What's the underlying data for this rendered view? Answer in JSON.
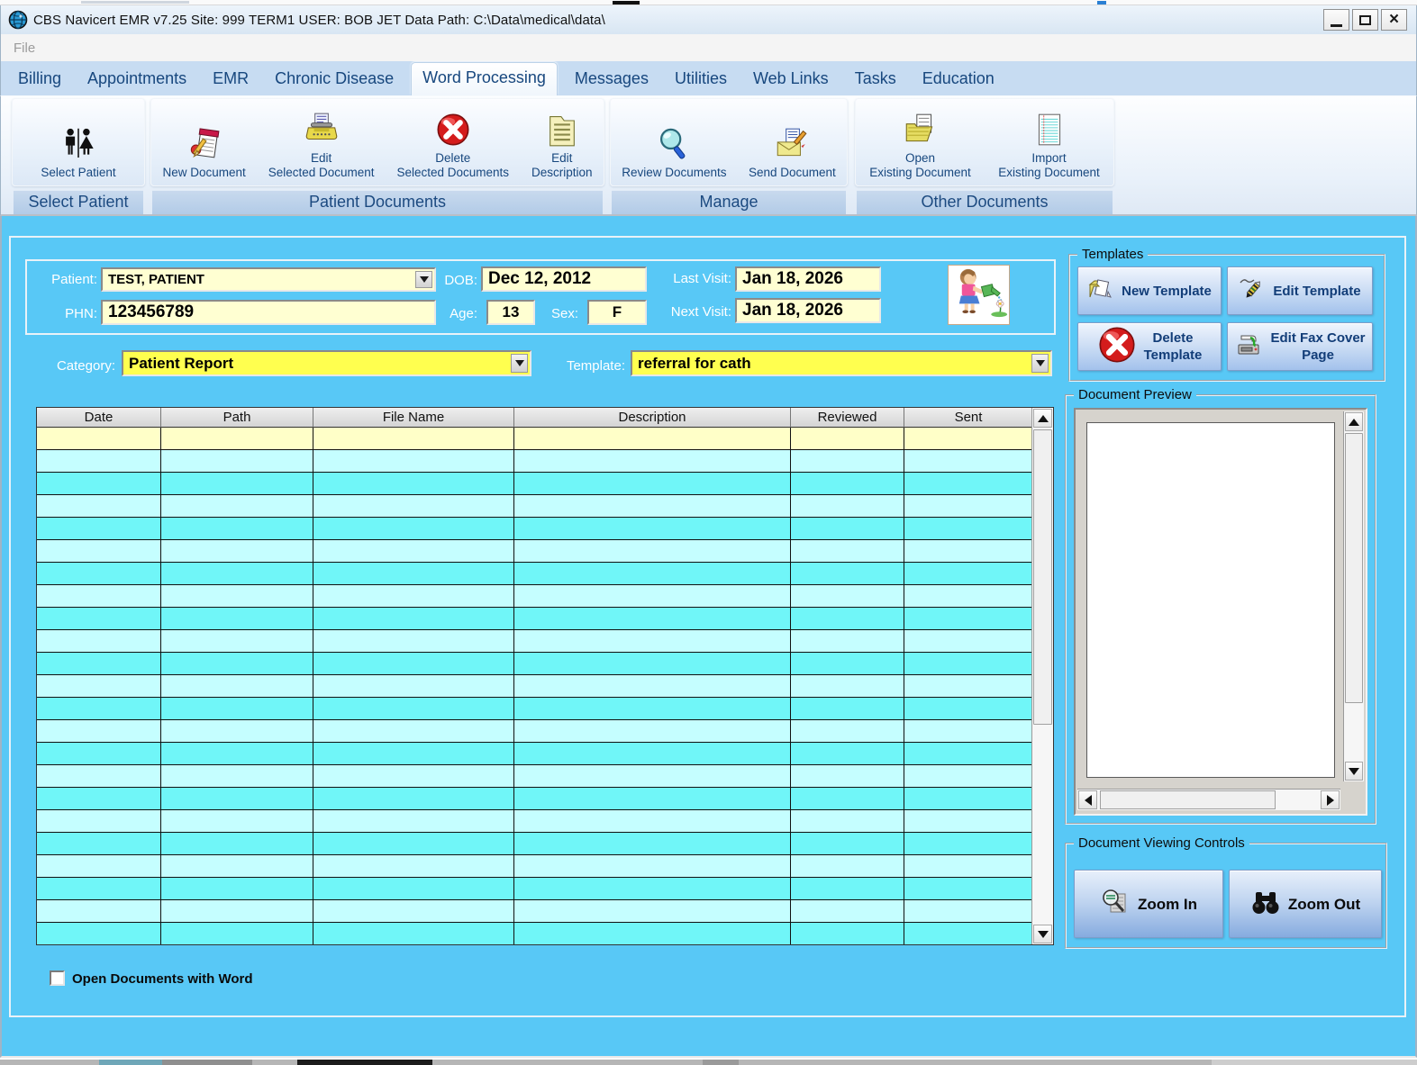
{
  "window": {
    "title": "CBS Navicert EMR v7.25 Site: 999 TERM1 USER: BOB  JET  Data Path: C:\\Data\\medical\\data\\"
  },
  "menu": {
    "file_label": "File"
  },
  "tabs": {
    "active": "Word Processing",
    "items": [
      {
        "label": "Billing"
      },
      {
        "label": "Appointments"
      },
      {
        "label": "EMR"
      },
      {
        "label": "Chronic Disease"
      },
      {
        "label": "Word Processing"
      },
      {
        "label": "Messages"
      },
      {
        "label": "Utilities"
      },
      {
        "label": "Web Links"
      },
      {
        "label": "Tasks"
      },
      {
        "label": "Education"
      }
    ]
  },
  "ribbon": {
    "groups": [
      {
        "label": "Select Patient",
        "buttons": [
          {
            "line1": "Select Patient",
            "line2": "",
            "icon": "select-patient-icon"
          }
        ]
      },
      {
        "label": "Patient Documents",
        "buttons": [
          {
            "line1": "New Document",
            "line2": "",
            "icon": "new-document-icon"
          },
          {
            "line1": "Edit",
            "line2": "Selected Document",
            "icon": "typewriter-icon"
          },
          {
            "line1": "Delete",
            "line2": "Selected Documents",
            "icon": "delete-circle-icon"
          },
          {
            "line1": "Edit",
            "line2": "Description",
            "icon": "folder-description-icon"
          }
        ]
      },
      {
        "label": "Manage",
        "buttons": [
          {
            "line1": "Review Documents",
            "line2": "",
            "icon": "magnifier-icon"
          },
          {
            "line1": "Send Document",
            "line2": "",
            "icon": "send-envelope-icon"
          }
        ]
      },
      {
        "label": "Other Documents",
        "buttons": [
          {
            "line1": "Open",
            "line2": "Existing Document",
            "icon": "open-folder-icon"
          },
          {
            "line1": "Import",
            "line2": "Existing Document",
            "icon": "import-notepad-icon"
          }
        ]
      }
    ]
  },
  "patient": {
    "patient_label": "Patient:",
    "name": "TEST, PATIENT",
    "phn_label": "PHN:",
    "phn": "123456789",
    "dob_label": "DOB:",
    "dob": "Dec 12, 2012",
    "age_label": "Age:",
    "age": "13",
    "sex_label": "Sex:",
    "sex": "F",
    "last_visit_label": "Last Visit:",
    "last_visit": "Jan 18, 2026",
    "next_visit_label": "Next Visit:",
    "next_visit": "Jan 18, 2026"
  },
  "filters": {
    "category_label": "Category:",
    "category_value": "Patient Report",
    "template_label": "Template:",
    "template_value": "referral for cath"
  },
  "documents_table": {
    "columns": [
      "Date",
      "Path",
      "File Name",
      "Description",
      "Reviewed",
      "Sent"
    ],
    "rows": [],
    "empty_row_count": 23
  },
  "templates_panel": {
    "title": "Templates",
    "new_template": "New Template",
    "edit_template": "Edit Template",
    "delete_template_line1": "Delete",
    "delete_template_line2": "Template",
    "edit_fax_line1": "Edit Fax Cover",
    "edit_fax_line2": "Page"
  },
  "preview_panel": {
    "title": "Document Preview"
  },
  "viewing_controls": {
    "title": "Document Viewing Controls",
    "zoom_in": "Zoom In",
    "zoom_out": "Zoom Out"
  },
  "footer": {
    "checkbox_label": "Open Documents with Word",
    "checkbox_checked": false
  },
  "colors": {
    "main_background": "#58c8f6",
    "field_yellow": "#ffffd2",
    "dropdown_yellow": "#ffff4f",
    "row_yellow": "#ffffc8",
    "row_cyan_light": "#c5feff",
    "row_cyan_bright": "#70f6f8",
    "tab_text": "#17477e",
    "delete_red": "#d42020"
  }
}
